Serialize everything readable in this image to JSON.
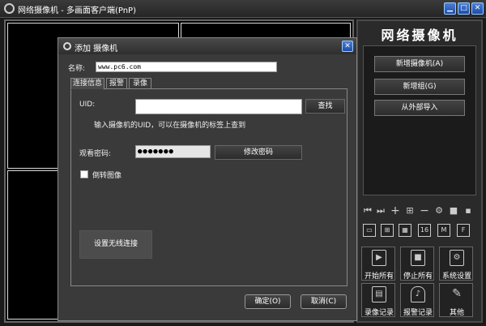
{
  "window": {
    "title": "网络摄像机 - 多画面客户端(PnP)",
    "min": "▁",
    "max": "□",
    "close": "✕"
  },
  "panel": {
    "title": "网络摄像机",
    "add_camera": "新增摄像机(A)",
    "add_group": "新增组(G)",
    "import": "从外部导入",
    "layout_16": "16",
    "layout_m": "M",
    "layout_f": "F",
    "start_all": "开始所有",
    "stop_all": "停止所有",
    "system_settings": "系统设置",
    "recordings": "录像记录",
    "alarm_log": "报警记录",
    "other": "其他"
  },
  "dialog": {
    "title": "添加 摄像机",
    "name_label": "名称:",
    "name_value": "www.pc6.com",
    "tabs": [
      "连接信息",
      "报警",
      "录像"
    ],
    "uid_label": "UID:",
    "uid_value": "",
    "search_button": "查找",
    "uid_hint": "输入摄像机的UID，可以在摄像机的标签上查到",
    "password_label": "观看密码:",
    "password_value": "●●●●●●●",
    "change_password": "修改密码",
    "flip_label": "倒转图像",
    "wireless_button": "设置无线连接",
    "ok_button": "确定(O)",
    "cancel_button": "取消(C)"
  },
  "colors": {
    "accent": "#1d4ca8",
    "background": "#1a1a1a"
  }
}
